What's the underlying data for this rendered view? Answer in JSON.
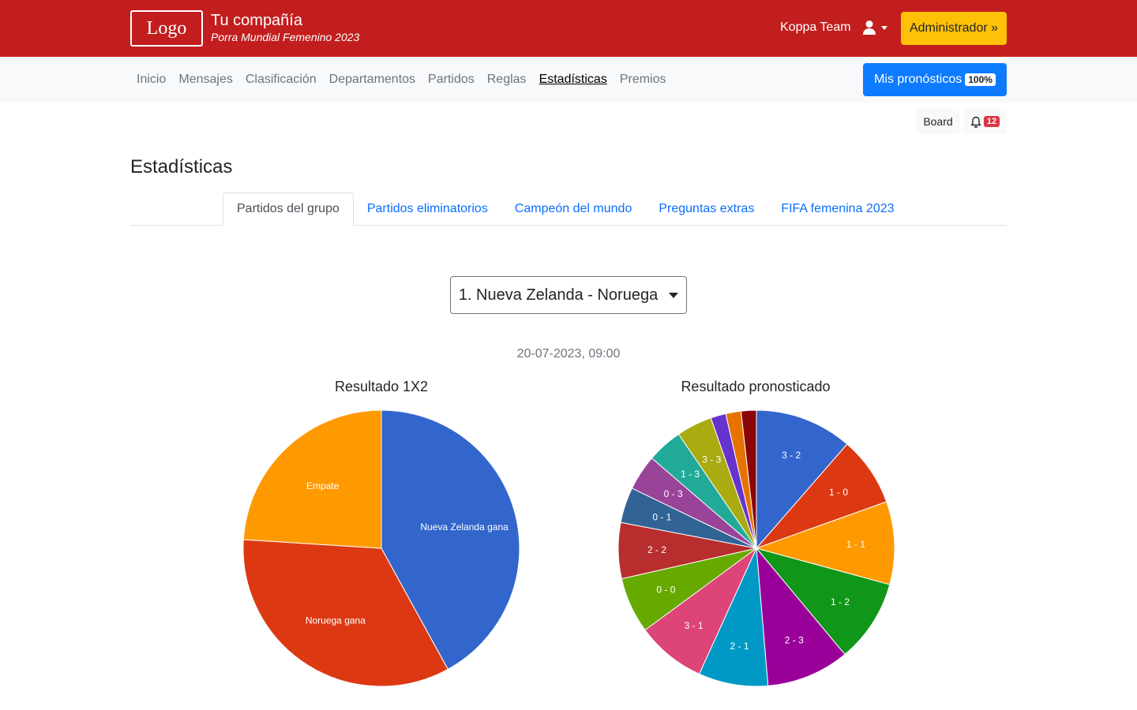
{
  "header": {
    "logo_text": "Logo",
    "company_name": "Tu compañía",
    "company_subtitle": "Porra Mundial Femenino 2023",
    "user_name": "Koppa Team",
    "user_icon": "user-icon",
    "admin_label": "Administrador »"
  },
  "nav": {
    "items": [
      {
        "label": "Inicio"
      },
      {
        "label": "Mensajes"
      },
      {
        "label": "Clasificación"
      },
      {
        "label": "Departamentos"
      },
      {
        "label": "Partidos"
      },
      {
        "label": "Reglas"
      },
      {
        "label": "Estadísticas",
        "active": true
      },
      {
        "label": "Premios"
      }
    ],
    "mis_label": "Mis pronósticos",
    "mis_percent": "100%"
  },
  "toolbar": {
    "board_label": "Board",
    "bell_icon": "bell-icon",
    "notifications": "12"
  },
  "page": {
    "title": "Estadísticas",
    "tabs": [
      {
        "label": "Partidos del grupo",
        "active": true
      },
      {
        "label": "Partidos eliminatorios"
      },
      {
        "label": "Campeón del mundo"
      },
      {
        "label": "Preguntas extras"
      },
      {
        "label": "FIFA femenina 2023"
      }
    ],
    "selected_match": "1. Nueva Zelanda - Noruega",
    "match_datetime": "20-07-2023, 09:00"
  },
  "colors": {
    "header_bg": "#c21e1e",
    "admin_btn": "#ffc107",
    "primary_btn": "#0d7bff"
  },
  "chart_data": [
    {
      "type": "pie",
      "title": "Resultado 1X2",
      "slices": [
        {
          "label": "Nueva Zelanda gana",
          "value": 42,
          "color": "#3366cc"
        },
        {
          "label": "Noruega gana",
          "value": 34,
          "color": "#dc3912"
        },
        {
          "label": "Empate",
          "value": 24,
          "color": "#ff9900"
        }
      ]
    },
    {
      "type": "pie",
      "title": "Resultado pronosticado",
      "slices": [
        {
          "label": "3 - 2",
          "value": 11.5,
          "color": "#3366cc"
        },
        {
          "label": "1 - 0",
          "value": 8.2,
          "color": "#dc3912"
        },
        {
          "label": "1 - 1",
          "value": 9.8,
          "color": "#ff9900"
        },
        {
          "label": "1 - 2",
          "value": 9.8,
          "color": "#109618"
        },
        {
          "label": "2 - 3",
          "value": 9.8,
          "color": "#990099"
        },
        {
          "label": "2 - 1",
          "value": 8.2,
          "color": "#0099c6"
        },
        {
          "label": "3 - 1",
          "value": 8.2,
          "color": "#dd4477"
        },
        {
          "label": "0 - 0",
          "value": 6.6,
          "color": "#66aa00"
        },
        {
          "label": "2 - 2",
          "value": 6.6,
          "color": "#b82e2e"
        },
        {
          "label": "0 - 1",
          "value": 4.2,
          "color": "#316395"
        },
        {
          "label": "0 - 3",
          "value": 4.2,
          "color": "#994499"
        },
        {
          "label": "1 - 3",
          "value": 4.2,
          "color": "#22aa99"
        },
        {
          "label": "3 - 3",
          "value": 4.2,
          "color": "#aaaa11"
        },
        {
          "label": "",
          "value": 1.8,
          "color": "#6633cc"
        },
        {
          "label": "",
          "value": 1.8,
          "color": "#e67300"
        },
        {
          "label": "",
          "value": 1.8,
          "color": "#8b0707"
        }
      ]
    }
  ]
}
